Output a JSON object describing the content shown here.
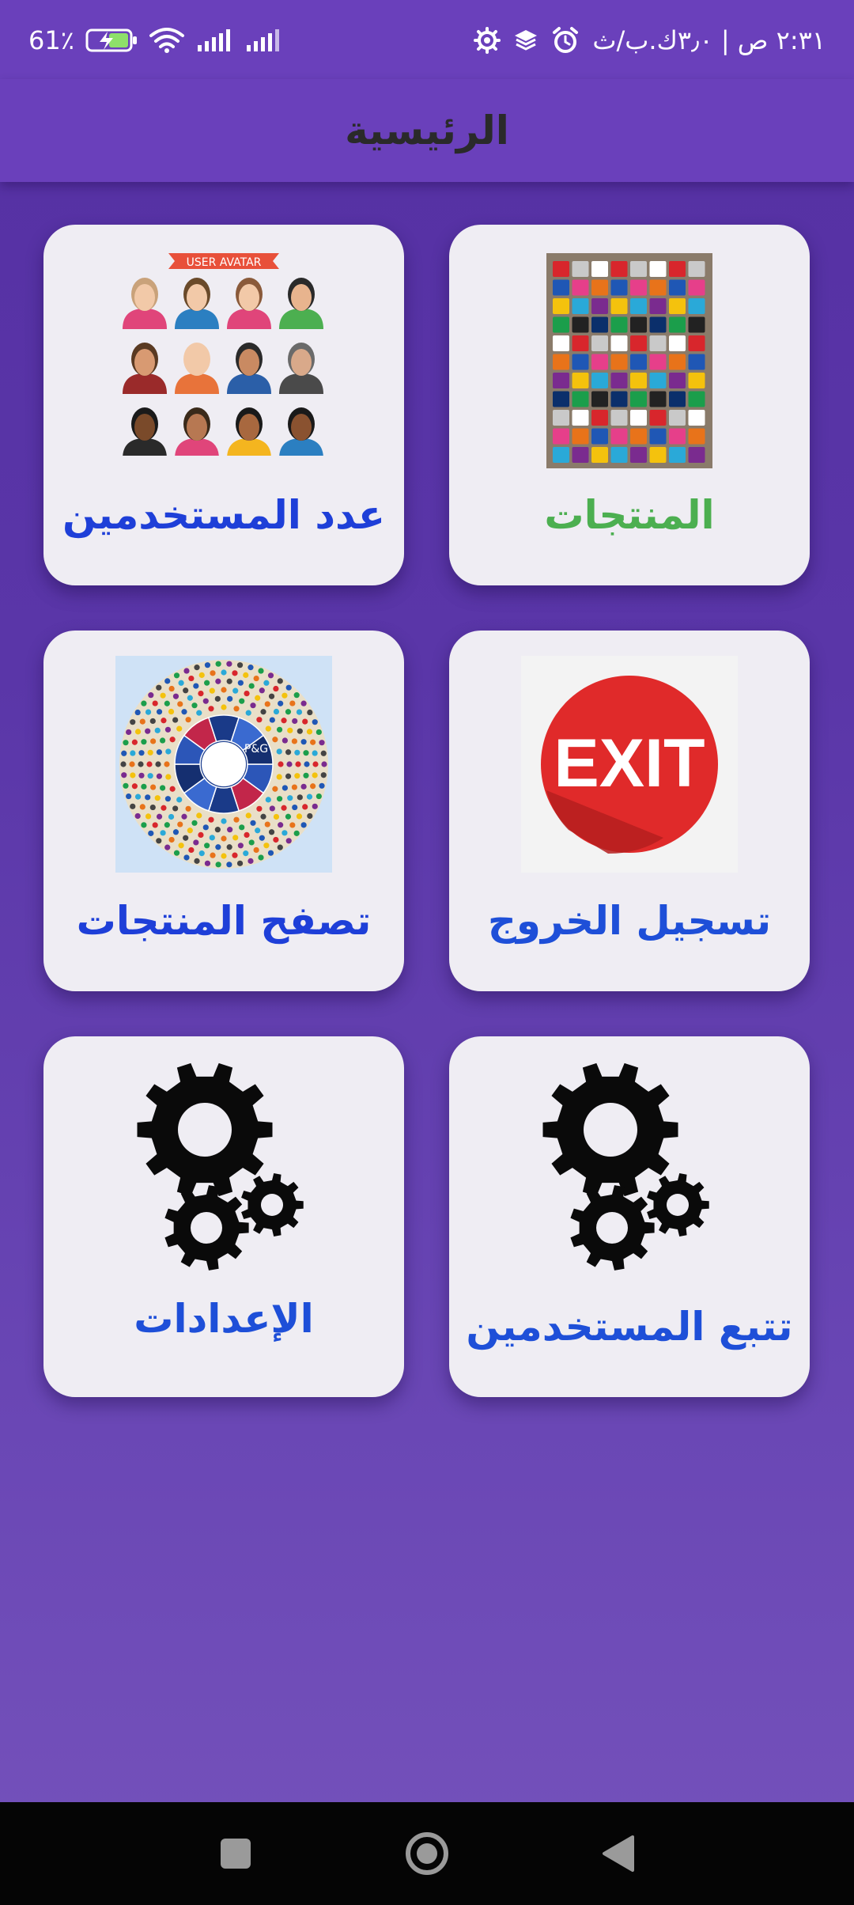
{
  "status_bar": {
    "time": "٢:٣١ ص | ٣٫٠ك.ب/ث",
    "battery": "61٪"
  },
  "app_bar": {
    "title": "الرئيسية"
  },
  "cards": [
    {
      "id": "products",
      "label": "المنتجات",
      "label_color": "#4caf50",
      "image": "product-brands-image"
    },
    {
      "id": "users-count",
      "label": "عدد المستخدمين",
      "label_color": "#1e3fd8",
      "image": "user-avatar-image",
      "image_caption": "USER AVATAR"
    },
    {
      "id": "logout",
      "label": "تسجيل الخروج",
      "label_color": "#1e4fd8",
      "image": "exit-sign-image",
      "image_caption": "EXIT"
    },
    {
      "id": "browse-products",
      "label": "تصفح المنتجات",
      "label_color": "#1e3fd8",
      "image": "brands-wheel-image",
      "image_caption": "P&G"
    },
    {
      "id": "track-users",
      "label": "تتبع المستخدمين",
      "label_color": "#1e4fd8",
      "image": "gears-icon"
    },
    {
      "id": "settings",
      "label": "الإعدادات",
      "label_color": "#1e4fd8",
      "image": "gears-icon"
    }
  ],
  "colors": {
    "app_bar": "#6a40bb",
    "background_top": "#5530a3",
    "background_bottom": "#7552bb",
    "card": "#efedf3",
    "nav_bar": "#050505"
  }
}
